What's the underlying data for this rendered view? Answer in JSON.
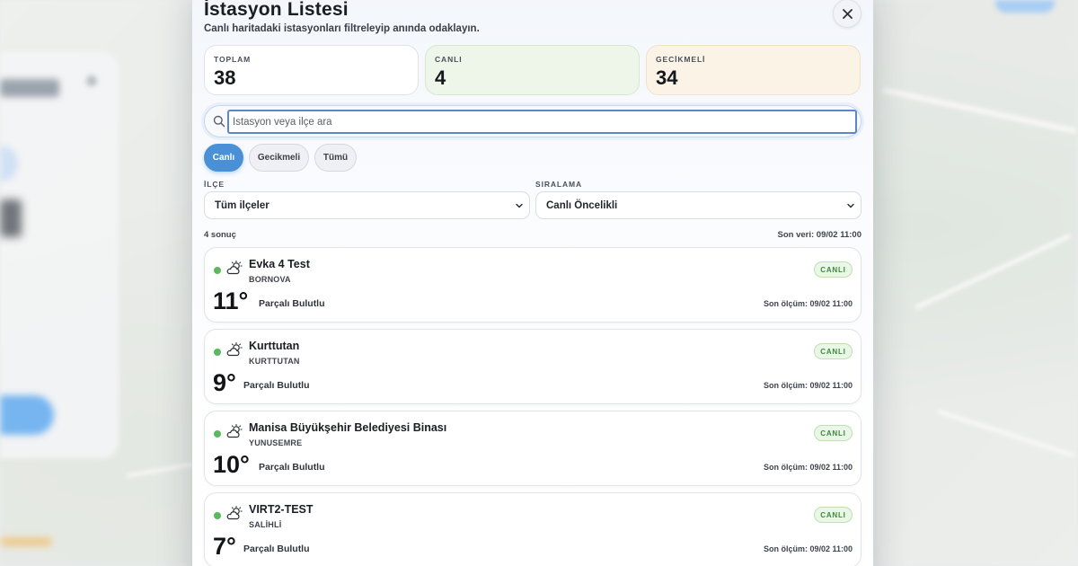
{
  "modal": {
    "title": "İstasyon Listesi",
    "subtitle": "Canlı haritadaki istasyonları filtreleyip anında odaklayın."
  },
  "stats": [
    {
      "label": "TOPLAM",
      "value": "38"
    },
    {
      "label": "CANLI",
      "value": "4"
    },
    {
      "label": "GECİKMELİ",
      "value": "34"
    }
  ],
  "search": {
    "placeholder": "İstasyon veya ilçe ara",
    "value": ""
  },
  "filters": [
    {
      "label": "Canlı",
      "active": true
    },
    {
      "label": "Gecikmeli",
      "active": false
    },
    {
      "label": "Tümü",
      "active": false
    }
  ],
  "district": {
    "label": "İLÇE",
    "selected": "Tüm ilçeler"
  },
  "sorting": {
    "label": "SIRALAMA",
    "selected": "Canlı Öncelikli"
  },
  "results": {
    "count_text": "4 sonuç",
    "last_data_text": "Son veri: 09/02 11:00"
  },
  "stations": [
    {
      "name": "Evka 4 Test",
      "district": "BORNOVA",
      "status": "CANLI",
      "temp": "11°",
      "condition": "Parçalı Bulutlu",
      "last_measure": "Son ölçüm: 09/02 11:00",
      "icon": "partly-cloudy-icon"
    },
    {
      "name": "Kurttutan",
      "district": "KURTTUTAN",
      "status": "CANLI",
      "temp": "9°",
      "condition": "Parçalı Bulutlu",
      "last_measure": "Son ölçüm: 09/02 11:00",
      "icon": "partly-cloudy-icon"
    },
    {
      "name": "Manisa Büyükşehir Belediyesi Binası",
      "district": "YUNUSEMRE",
      "status": "CANLI",
      "temp": "10°",
      "condition": "Parçalı Bulutlu",
      "last_measure": "Son ölçüm: 09/02 11:00",
      "icon": "partly-cloudy-icon"
    },
    {
      "name": "VIRT2-TEST",
      "district": "SALİHLİ",
      "status": "CANLI",
      "temp": "7°",
      "condition": "Parçalı Bulutlu",
      "last_measure": "Son ölçüm: 09/02 11:00",
      "icon": "partly-cloudy-icon"
    }
  ],
  "colors": {
    "accent": "#4a90d6",
    "live_dot": "#5cb85c",
    "live_bg": "#eef6ea",
    "late_bg": "#fbf4e6"
  }
}
